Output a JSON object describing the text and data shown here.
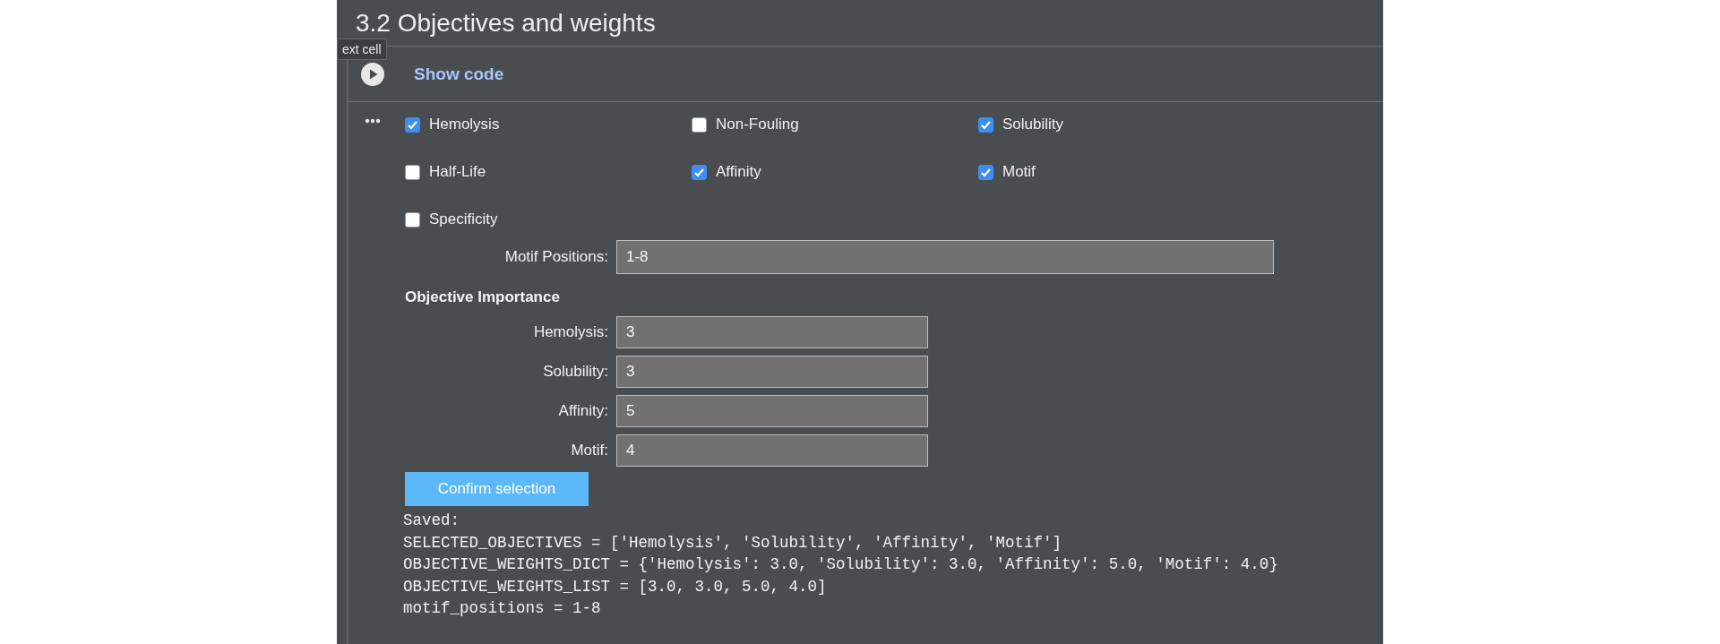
{
  "section_title": "3.2 Objectives and weights",
  "tooltip": "ext cell",
  "code_toggle": {
    "label": "Show code"
  },
  "objectives": [
    {
      "label": "Hemolysis",
      "checked": true
    },
    {
      "label": "Non-Fouling",
      "checked": false
    },
    {
      "label": "Solubility",
      "checked": true
    },
    {
      "label": "Half-Life",
      "checked": false
    },
    {
      "label": "Affinity",
      "checked": true
    },
    {
      "label": "Motif",
      "checked": true
    },
    {
      "label": "Specificity",
      "checked": false
    }
  ],
  "motif_positions": {
    "label": "Motif Positions:",
    "value": "1-8"
  },
  "importance": {
    "heading": "Objective Importance",
    "weights": [
      {
        "label": "Hemolysis:",
        "value": "3"
      },
      {
        "label": "Solubility:",
        "value": "3"
      },
      {
        "label": "Affinity:",
        "value": "5"
      },
      {
        "label": "Motif:",
        "value": "4"
      }
    ]
  },
  "confirm_button": "Confirm selection",
  "output": [
    "Saved:",
    "SELECTED_OBJECTIVES = ['Hemolysis', 'Solubility', 'Affinity', 'Motif']",
    "OBJECTIVE_WEIGHTS_DICT = {'Hemolysis': 3.0, 'Solubility': 3.0, 'Affinity': 5.0, 'Motif': 4.0}",
    "OBJECTIVE_WEIGHTS_LIST = [3.0, 3.0, 5.0, 4.0]",
    "motif_positions = 1-8"
  ]
}
